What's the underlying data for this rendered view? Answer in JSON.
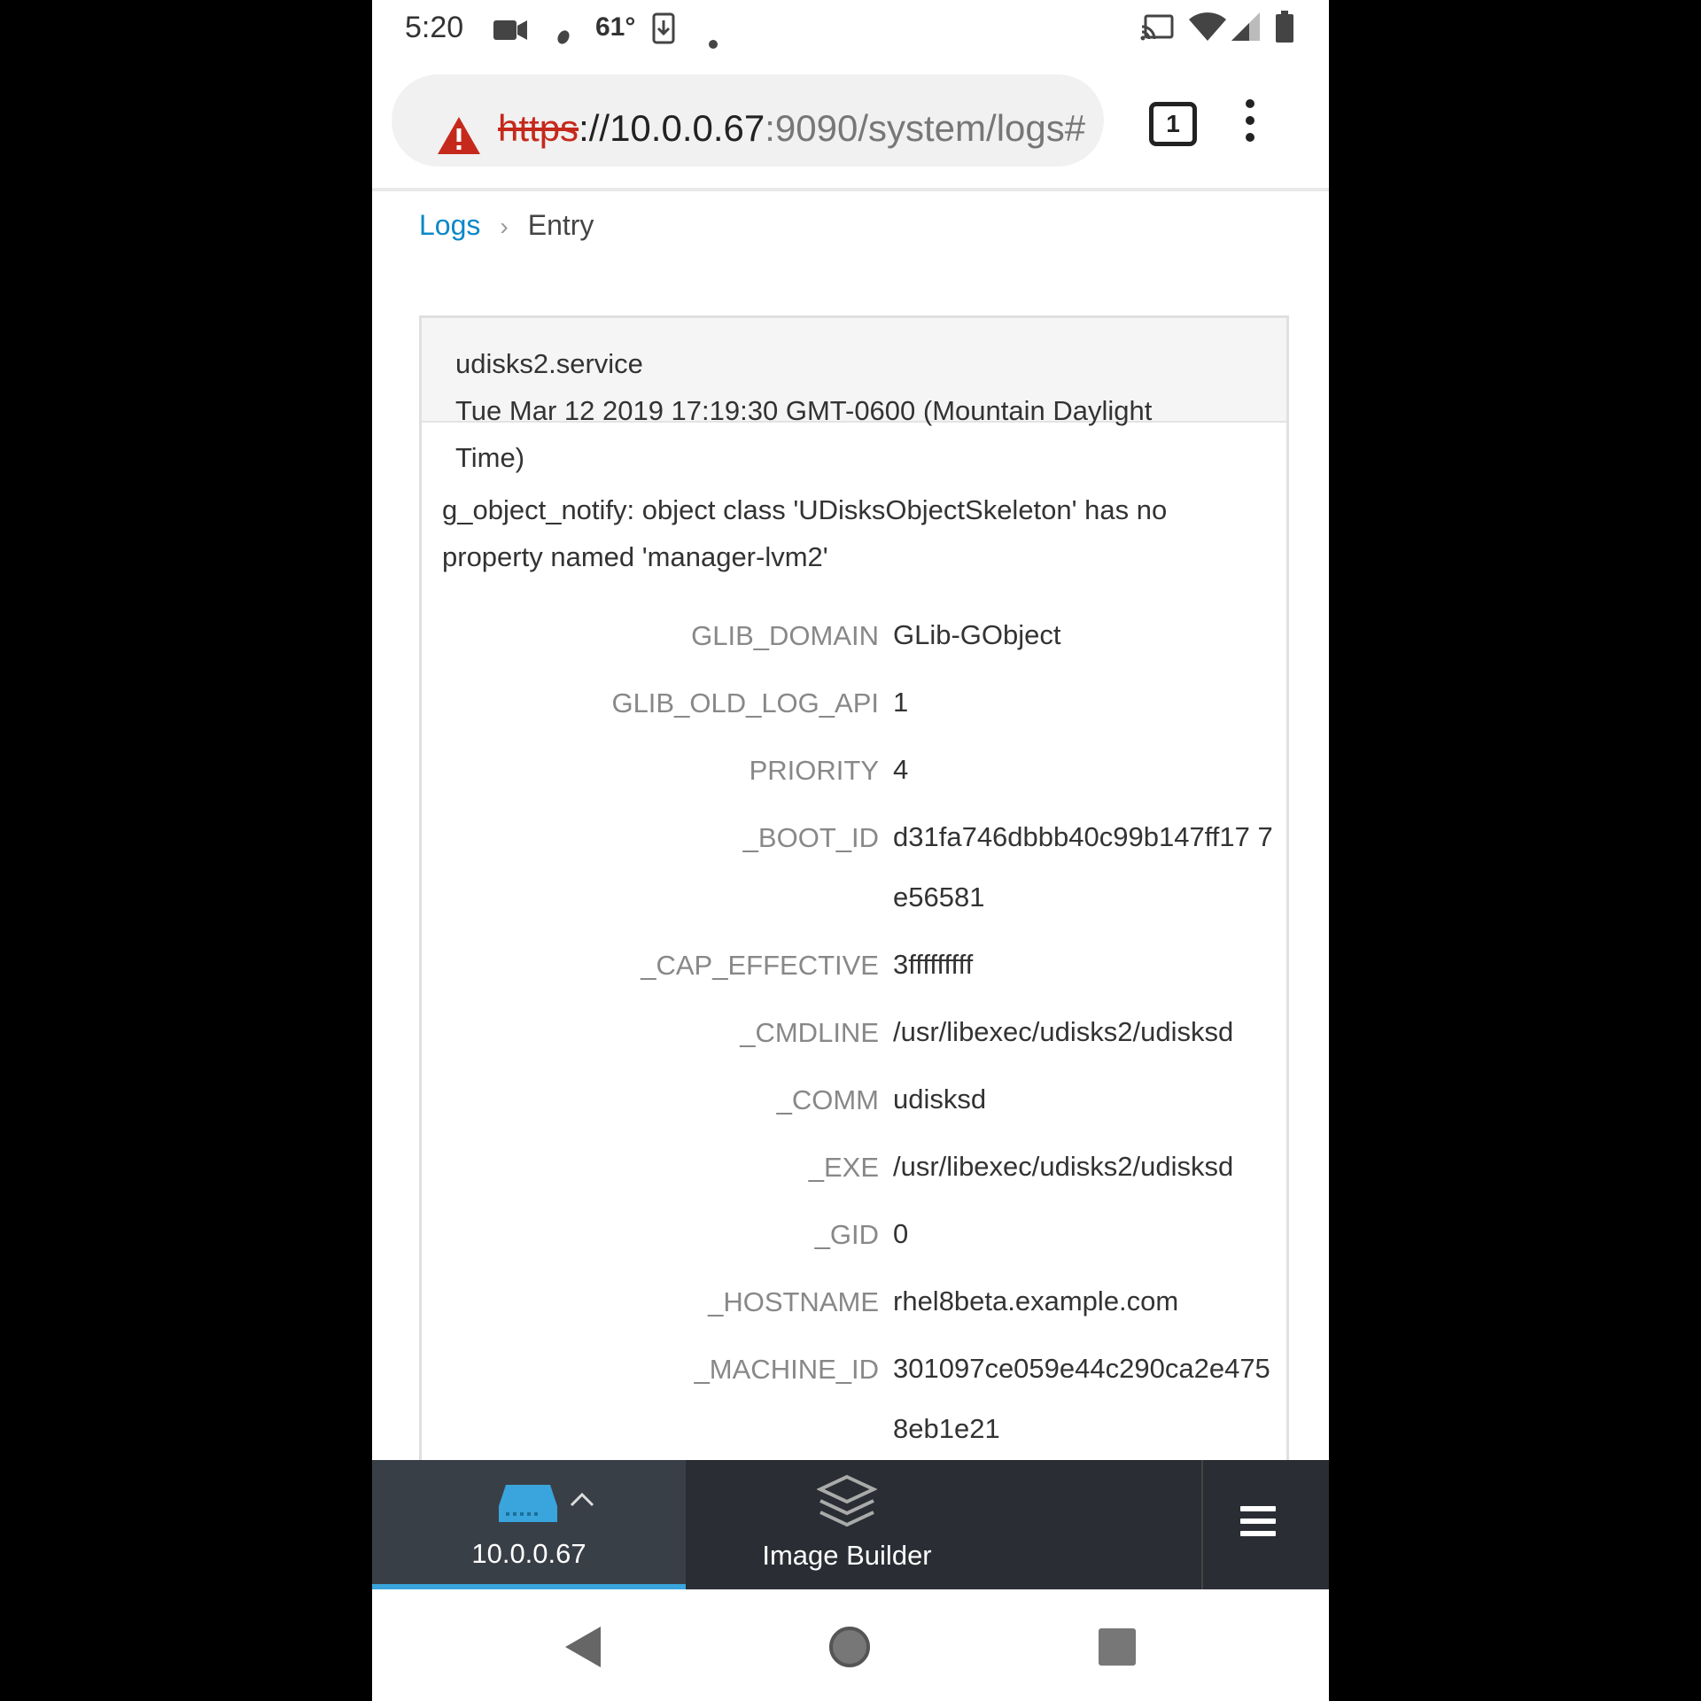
{
  "status_bar": {
    "time": "5:20",
    "temperature": "61°",
    "icons": [
      "video-icon",
      "leaf-icon",
      "download-icon",
      "dot-icon",
      "cast-icon",
      "wifi-icon",
      "signal-icon",
      "battery-icon"
    ]
  },
  "browser": {
    "url_scheme": "https",
    "url_host": "://10.0.0.67",
    "url_path": ":9090/system/logs#",
    "tab_count": "1"
  },
  "breadcrumb": {
    "root": "Logs",
    "separator": "›",
    "current": "Entry"
  },
  "entry": {
    "service": "udisks2.service",
    "timestamp_line1": "Tue Mar 12 2019 17:19:30 GMT-0600 (Mountain Daylight",
    "timestamp_line2": "Time)",
    "message": "g_object_notify: object class 'UDisksObjectSkeleton' has no property named 'manager-lvm2'",
    "fields": [
      {
        "key": "GLIB_DOMAIN",
        "value": "GLib-GObject"
      },
      {
        "key": "GLIB_OLD_LOG_API",
        "value": "1"
      },
      {
        "key": "PRIORITY",
        "value": "4"
      },
      {
        "key": "_BOOT_ID",
        "value": "d31fa746dbbb40c99b147ff17 7e56581"
      },
      {
        "key": "_CAP_EFFECTIVE",
        "value": "3fffffffff"
      },
      {
        "key": "_CMDLINE",
        "value": "/usr/libexec/udisks2/udisksd"
      },
      {
        "key": "_COMM",
        "value": "udisksd"
      },
      {
        "key": "_EXE",
        "value": "/usr/libexec/udisks2/udisksd"
      },
      {
        "key": "_GID",
        "value": "0"
      },
      {
        "key": "_HOSTNAME",
        "value": "rhel8beta.example.com"
      },
      {
        "key": "_MACHINE_ID",
        "value": "301097ce059e44c290ca2e475 8eb1e21"
      }
    ]
  },
  "bottom_nav": {
    "host_label": "10.0.0.67",
    "app_label": "Image Builder"
  },
  "colors": {
    "link": "#0a88c8",
    "insecure": "#c5291c",
    "nav_bg": "#2a2d33",
    "nav_active": "#393f47",
    "nav_accent": "#39a5dc"
  }
}
